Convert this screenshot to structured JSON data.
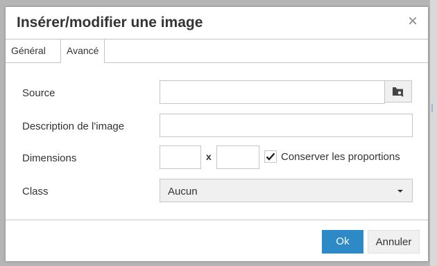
{
  "dialog": {
    "title": "Insérer/modifier une image",
    "close_icon": "close-icon",
    "close_glyph": "×"
  },
  "tabs": [
    {
      "label": "Général",
      "active": false
    },
    {
      "label": "Avancé",
      "active": true
    }
  ],
  "form": {
    "source": {
      "label": "Source",
      "value": "",
      "browse_icon": "browse-folder-icon"
    },
    "description": {
      "label": "Description de l'image",
      "value": ""
    },
    "dimensions": {
      "label": "Dimensions",
      "width": "",
      "height": "",
      "separator": "x",
      "constrain_label": "Conserver les proportions",
      "constrain_checked": true
    },
    "class": {
      "label": "Class",
      "selected": "Aucun"
    }
  },
  "footer": {
    "ok_label": "Ok",
    "cancel_label": "Annuler"
  },
  "colors": {
    "primary": "#2d8ac7",
    "border": "#c5c5c5",
    "text": "#333333",
    "backdrop": "#b5b5b5"
  }
}
